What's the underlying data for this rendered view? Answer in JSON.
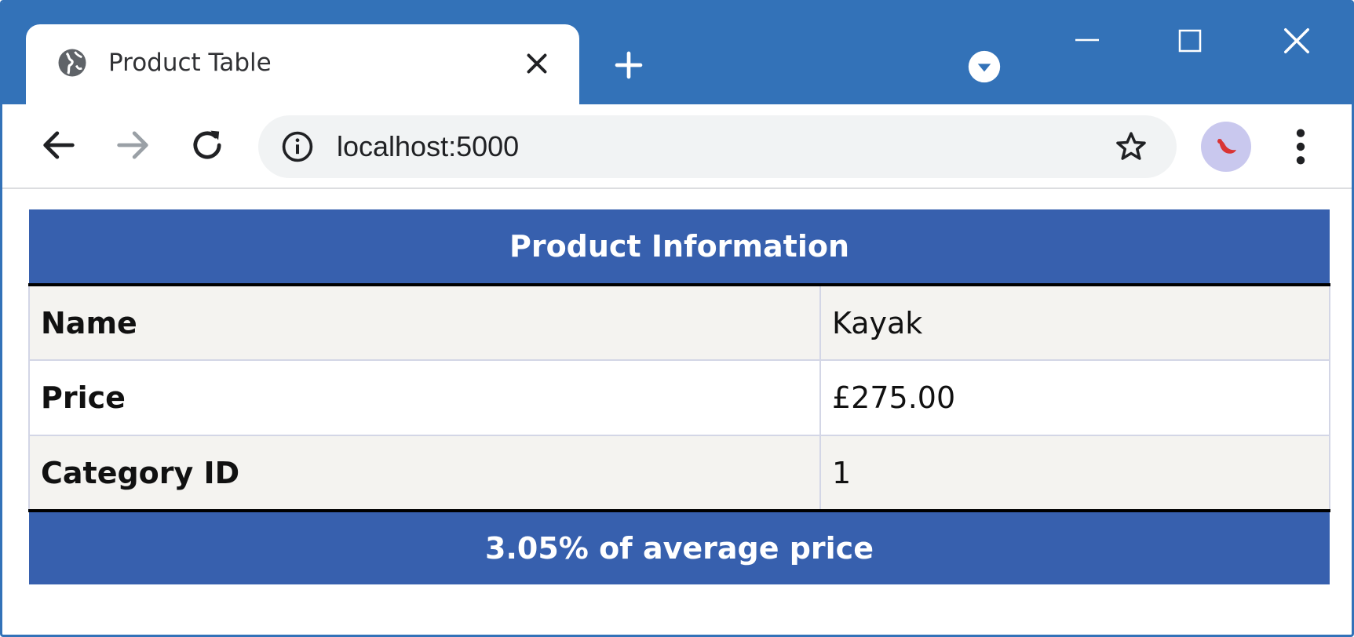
{
  "browser": {
    "tab_title": "Product Table",
    "url": "localhost:5000"
  },
  "table": {
    "header": "Product Information",
    "rows": [
      {
        "label": "Name",
        "value": "Kayak"
      },
      {
        "label": "Price",
        "value": "£275.00"
      },
      {
        "label": "Category ID",
        "value": "1"
      }
    ],
    "footer": "3.05% of average price"
  },
  "colors": {
    "titlebar": "#3372b8",
    "table_header": "#3760ae",
    "row_stripe": "#f4f3f0"
  },
  "icons": {
    "tab": "globe-icon",
    "close_tab": "close-icon",
    "new_tab": "plus-icon",
    "tab_search": "chevron-down-icon",
    "back": "arrow-left-icon",
    "forward": "arrow-right-icon",
    "reload": "reload-icon",
    "site_info": "info-icon",
    "bookmark": "star-icon",
    "profile": "avatar",
    "menu": "kebab-menu-icon"
  }
}
